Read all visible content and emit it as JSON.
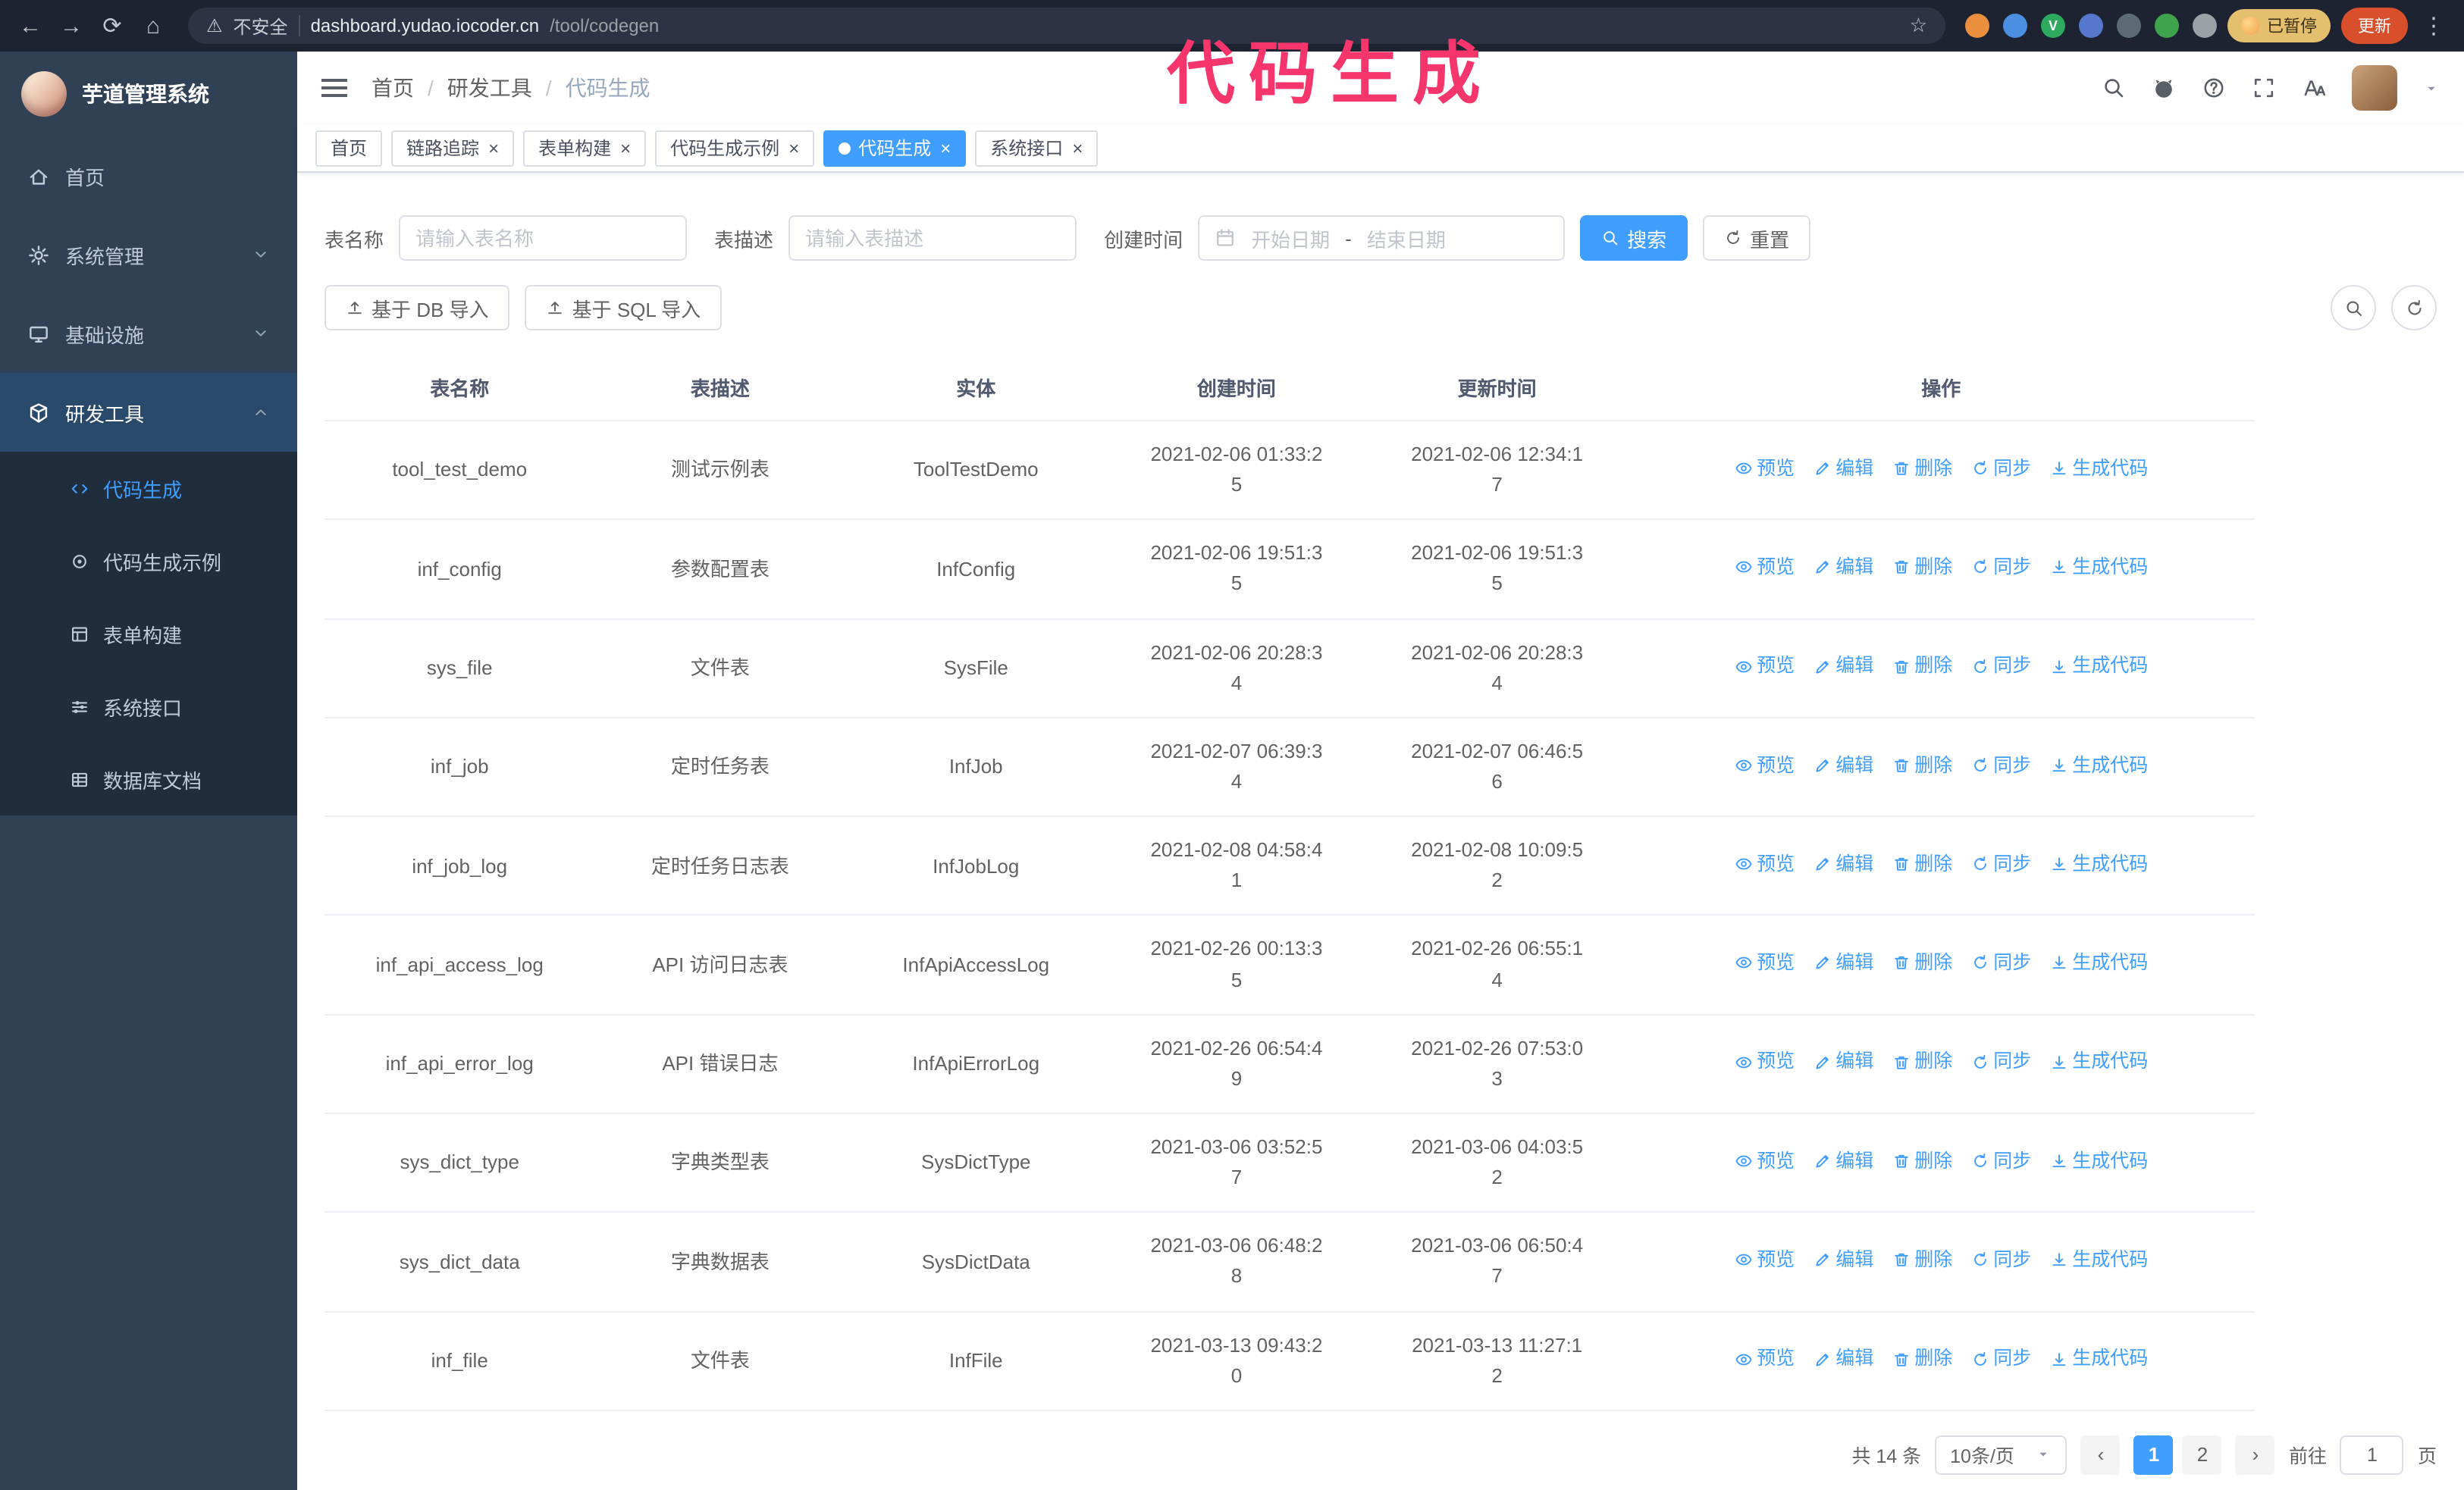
{
  "browser": {
    "security_text": "不安全",
    "url_host": "dashboard.yudao.iocoder.cn",
    "url_path": "/tool/codegen",
    "paused_badge": "已暂停",
    "update_button": "更新",
    "extensions": [
      {
        "name": "extension-orange",
        "color": "#e98f3e",
        "letter": ""
      },
      {
        "name": "extension-blue",
        "color": "#4a8fe2",
        "letter": ""
      },
      {
        "name": "extension-green-v",
        "color": "#2eaa5e",
        "letter": "V"
      },
      {
        "name": "extension-people",
        "color": "#5577cc",
        "letter": ""
      },
      {
        "name": "extension-slate",
        "color": "#5d6b75",
        "letter": ""
      },
      {
        "name": "extension-leaf",
        "color": "#3fa34d",
        "letter": ""
      },
      {
        "name": "extension-puzzle",
        "color": "#9aa0a6",
        "letter": ""
      }
    ]
  },
  "annotation": "代码生成",
  "sidebar": {
    "logo_title": "芋道管理系统",
    "items": [
      {
        "id": "home",
        "label": "首页",
        "icon": "home-icon",
        "symbol": "i-home",
        "expandable": false,
        "expanded": false
      },
      {
        "id": "system",
        "label": "系统管理",
        "icon": "gear-icon",
        "symbol": "i-gear",
        "expandable": true,
        "expanded": false
      },
      {
        "id": "infra",
        "label": "基础设施",
        "icon": "monitor-icon",
        "symbol": "i-monitor",
        "expandable": true,
        "expanded": false
      },
      {
        "id": "devtools",
        "label": "研发工具",
        "icon": "cube-icon",
        "symbol": "i-cube",
        "expandable": true,
        "expanded": true,
        "children": [
          {
            "id": "codegen",
            "label": "代码生成",
            "icon": "code-icon",
            "symbol": "i-code",
            "active": true
          },
          {
            "id": "codegen-demo",
            "label": "代码生成示例",
            "icon": "target-icon",
            "symbol": "i-target",
            "active": false
          },
          {
            "id": "form-builder",
            "label": "表单构建",
            "icon": "form-icon",
            "symbol": "i-form",
            "active": false
          },
          {
            "id": "system-api",
            "label": "系统接口",
            "icon": "sliders-icon",
            "symbol": "i-sliders",
            "active": false
          },
          {
            "id": "db-doc",
            "label": "数据库文档",
            "icon": "table-grid-icon",
            "symbol": "i-table",
            "active": false
          }
        ]
      }
    ]
  },
  "header": {
    "breadcrumb": [
      "首页",
      "研发工具",
      "代码生成"
    ]
  },
  "tabs": [
    {
      "id": "home",
      "label": "首页",
      "closable": false,
      "active": false
    },
    {
      "id": "tracing",
      "label": "链路追踪",
      "closable": true,
      "active": false
    },
    {
      "id": "form-builder",
      "label": "表单构建",
      "closable": true,
      "active": false
    },
    {
      "id": "codegen-demo",
      "label": "代码生成示例",
      "closable": true,
      "active": false
    },
    {
      "id": "codegen",
      "label": "代码生成",
      "closable": true,
      "active": true
    },
    {
      "id": "system-api",
      "label": "系统接口",
      "closable": true,
      "active": false
    }
  ],
  "filters": {
    "table_name_label": "表名称",
    "table_name_placeholder": "请输入表名称",
    "table_desc_label": "表描述",
    "table_desc_placeholder": "请输入表描述",
    "create_time_label": "创建时间",
    "date_start_placeholder": "开始日期",
    "date_separator": "-",
    "date_end_placeholder": "结束日期",
    "search_button": "搜索",
    "reset_button": "重置"
  },
  "toolbar": {
    "import_db_button": "基于 DB 导入",
    "import_sql_button": "基于 SQL 导入"
  },
  "table": {
    "columns": [
      "表名称",
      "表描述",
      "实体",
      "创建时间",
      "更新时间",
      "操作"
    ],
    "action_labels": [
      "预览",
      "编辑",
      "删除",
      "同步",
      "生成代码"
    ],
    "rows": [
      {
        "name": "tool_test_demo",
        "desc": "测试示例表",
        "entity": "ToolTestDemo",
        "created": "2021-02-06 01:33:25",
        "updated": "2021-02-06 12:34:17"
      },
      {
        "name": "inf_config",
        "desc": "参数配置表",
        "entity": "InfConfig",
        "created": "2021-02-06 19:51:35",
        "updated": "2021-02-06 19:51:35"
      },
      {
        "name": "sys_file",
        "desc": "文件表",
        "entity": "SysFile",
        "created": "2021-02-06 20:28:34",
        "updated": "2021-02-06 20:28:34"
      },
      {
        "name": "inf_job",
        "desc": "定时任务表",
        "entity": "InfJob",
        "created": "2021-02-07 06:39:34",
        "updated": "2021-02-07 06:46:56"
      },
      {
        "name": "inf_job_log",
        "desc": "定时任务日志表",
        "entity": "InfJobLog",
        "created": "2021-02-08 04:58:41",
        "updated": "2021-02-08 10:09:52"
      },
      {
        "name": "inf_api_access_log",
        "desc": "API 访问日志表",
        "entity": "InfApiAccessLog",
        "created": "2021-02-26 00:13:35",
        "updated": "2021-02-26 06:55:14"
      },
      {
        "name": "inf_api_error_log",
        "desc": "API 错误日志",
        "entity": "InfApiErrorLog",
        "created": "2021-02-26 06:54:49",
        "updated": "2021-02-26 07:53:03"
      },
      {
        "name": "sys_dict_type",
        "desc": "字典类型表",
        "entity": "SysDictType",
        "created": "2021-03-06 03:52:57",
        "updated": "2021-03-06 04:03:52"
      },
      {
        "name": "sys_dict_data",
        "desc": "字典数据表",
        "entity": "SysDictData",
        "created": "2021-03-06 06:48:28",
        "updated": "2021-03-06 06:50:47"
      },
      {
        "name": "inf_file",
        "desc": "文件表",
        "entity": "InfFile",
        "created": "2021-03-13 09:43:20",
        "updated": "2021-03-13 11:27:12"
      }
    ]
  },
  "pagination": {
    "total_text": "共 14 条",
    "page_size_text": "10条/页",
    "pages": [
      "1",
      "2"
    ],
    "current_page": "1",
    "goto_label": "前往",
    "goto_value": "1",
    "goto_suffix": "页"
  },
  "colors": {
    "primary": "#409EFF",
    "annotation_pink": "#f5356b",
    "sidebar_bg": "#304156",
    "submenu_bg": "#1f2d3d"
  }
}
